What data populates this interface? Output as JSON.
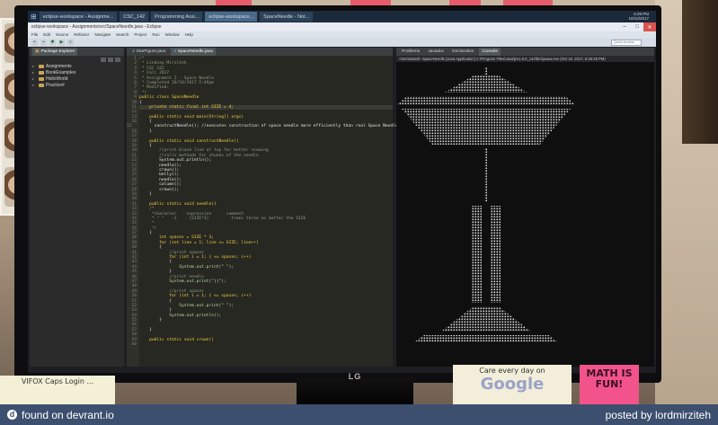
{
  "taskbar": {
    "tabs": [
      {
        "label": "eclipse-workspace - Assignme...",
        "active": false
      },
      {
        "label": "CSC_142",
        "active": false
      },
      {
        "label": "Programming Assi...",
        "active": false
      },
      {
        "label": "eclipse-workspace...",
        "active": true
      },
      {
        "label": "SpaceNeedle - Not...",
        "active": false
      }
    ],
    "clock_time": "6:29 PM",
    "clock_date": "10/10/2017"
  },
  "window": {
    "title": "eclipse-workspace - Assignments/src/SpaceNeedle.java - Eclipse",
    "minimize": "–",
    "maximize": "□",
    "close": "✕"
  },
  "menu": [
    "File",
    "Edit",
    "Source",
    "Refactor",
    "Navigate",
    "Search",
    "Project",
    "Run",
    "Window",
    "Help"
  ],
  "toolbar": {
    "quick_access_placeholder": "Quick Access",
    "tools": [
      "new-icon",
      "save-icon",
      "debug-icon",
      "run-icon",
      "search-icon"
    ]
  },
  "package_explorer": {
    "tab_label": "Package Explorer",
    "items": [
      {
        "label": "Assignments"
      },
      {
        "label": "BookExamples"
      },
      {
        "label": "HelloWorld"
      },
      {
        "label": "Practice#"
      }
    ]
  },
  "editor": {
    "tabs": [
      {
        "label": "StarFigure.java",
        "active": false
      },
      {
        "label": "SpaceNeedle.java",
        "active": true
      }
    ],
    "lines": [
      {
        "n": "1",
        "t": "/*",
        "c": "cm"
      },
      {
        "n": "2",
        "t": " * Lindsay Mirziteh",
        "c": "cm"
      },
      {
        "n": "3",
        "t": " * CSC 142",
        "c": "cm"
      },
      {
        "n": "4",
        "t": " * Fall 2017",
        "c": "cm"
      },
      {
        "n": "5",
        "t": " * Assignment 2 - Space Needle",
        "c": "cm"
      },
      {
        "n": "6",
        "t": " * Completed 10/10/2017 5:49pm",
        "c": "cm"
      },
      {
        "n": "7",
        "t": " * Modified: ",
        "c": "cm"
      },
      {
        "n": "8",
        "t": " */",
        "c": "cm"
      },
      {
        "n": "9",
        "t": "public class SpaceNeedle",
        "c": "kw"
      },
      {
        "n": "10",
        "t": "{",
        "c": ""
      },
      {
        "n": "11",
        "t": "    private static final int SIZE = 4;",
        "c": "kw",
        "hl": true
      },
      {
        "n": "12",
        "t": "",
        "c": ""
      },
      {
        "n": "13",
        "t": "    public static void main(String[] args)",
        "c": "kw"
      },
      {
        "n": "14",
        "t": "    {",
        "c": ""
      },
      {
        "n": "15",
        "t": "        constructNeedle(); //executes construction of space needle more efficiently than real Space Needle",
        "c": ""
      },
      {
        "n": "16",
        "t": "    }",
        "c": ""
      },
      {
        "n": "17",
        "t": "",
        "c": ""
      },
      {
        "n": "18",
        "t": "    public static void constructNeedle()",
        "c": "kw"
      },
      {
        "n": "19",
        "t": "    {",
        "c": ""
      },
      {
        "n": "20",
        "t": "        //print blank line at top for better viewing",
        "c": "cm"
      },
      {
        "n": "21",
        "t": "        //calls methods for chunks of the needle",
        "c": "cm"
      },
      {
        "n": "22",
        "t": "        System.out.println();",
        "c": ""
      },
      {
        "n": "23",
        "t": "        needle();",
        "c": ""
      },
      {
        "n": "24",
        "t": "        crown();",
        "c": ""
      },
      {
        "n": "25",
        "t": "        belly();",
        "c": ""
      },
      {
        "n": "26",
        "t": "        needle();",
        "c": ""
      },
      {
        "n": "27",
        "t": "        column();",
        "c": ""
      },
      {
        "n": "28",
        "t": "        crown();",
        "c": ""
      },
      {
        "n": "29",
        "t": "    }",
        "c": ""
      },
      {
        "n": "30",
        "t": "",
        "c": ""
      },
      {
        "n": "31",
        "t": "    public static void needle()",
        "c": "kw"
      },
      {
        "n": "32",
        "t": "    /*",
        "c": "cm"
      },
      {
        "n": "33",
        "t": "     *character    expression      comment",
        "c": "cm"
      },
      {
        "n": "34",
        "t": "     * \" \"   -1     (SIZE*3)         times three no matter the SIZE",
        "c": "cm"
      },
      {
        "n": "35",
        "t": "     * ",
        "c": "cm"
      },
      {
        "n": "36",
        "t": "     */",
        "c": "cm"
      },
      {
        "n": "37",
        "t": "    {",
        "c": ""
      },
      {
        "n": "38",
        "t": "        int spaces = SIZE * 3;",
        "c": "kw"
      },
      {
        "n": "39",
        "t": "        for (int line = 1; line <= SIZE; line++)",
        "c": "kw"
      },
      {
        "n": "40",
        "t": "        {",
        "c": ""
      },
      {
        "n": "41",
        "t": "            //print spaces",
        "c": "cm"
      },
      {
        "n": "42",
        "t": "            for (int i = 1; i <= spaces; i++)",
        "c": "kw"
      },
      {
        "n": "43",
        "t": "            {",
        "c": ""
      },
      {
        "n": "44",
        "t": "                System.out.print(\" \");",
        "c": "str"
      },
      {
        "n": "45",
        "t": "            }",
        "c": ""
      },
      {
        "n": "46",
        "t": "            //print needle",
        "c": "cm"
      },
      {
        "n": "47",
        "t": "            System.out.print(\"||\");",
        "c": "str"
      },
      {
        "n": "48",
        "t": "",
        "c": ""
      },
      {
        "n": "49",
        "t": "            //print spaces",
        "c": "cm"
      },
      {
        "n": "50",
        "t": "            for (int i = 1; i <= spaces; i++)",
        "c": "kw"
      },
      {
        "n": "51",
        "t": "            {",
        "c": ""
      },
      {
        "n": "52",
        "t": "                System.out.print(\" \");",
        "c": "str"
      },
      {
        "n": "53",
        "t": "            }",
        "c": ""
      },
      {
        "n": "54",
        "t": "            System.out.println();",
        "c": "str"
      },
      {
        "n": "55",
        "t": "        }",
        "c": ""
      },
      {
        "n": "56",
        "t": "",
        "c": ""
      },
      {
        "n": "57",
        "t": "    }",
        "c": ""
      },
      {
        "n": "58",
        "t": "",
        "c": ""
      },
      {
        "n": "59",
        "t": "    public static void crown()",
        "c": "kw"
      },
      {
        "n": "60",
        "t": "",
        "c": ""
      }
    ]
  },
  "right_panel": {
    "tabs": [
      {
        "label": "Problems",
        "active": false
      },
      {
        "label": "Javadoc",
        "active": false
      },
      {
        "label": "Declaration",
        "active": false
      },
      {
        "label": "Console",
        "active": true
      }
    ],
    "console_header": "<terminated> SpaceNeedle [Java Application] C:\\Program Files\\Java\\jre1.8.0_144\\bin\\javaw.exe (Oct 10, 2017, 6:26:29 PM)"
  },
  "photo_notes": {
    "left_note": "VIFOX Caps Login ...",
    "middle_note_small": "Care every day on",
    "middle_note_big": "Google",
    "pink_note": "MATH IS FUN!"
  },
  "monitor": {
    "brand": "LG"
  },
  "footer": {
    "left": "found on devrant.io",
    "right": "posted by lordmirziteh"
  }
}
